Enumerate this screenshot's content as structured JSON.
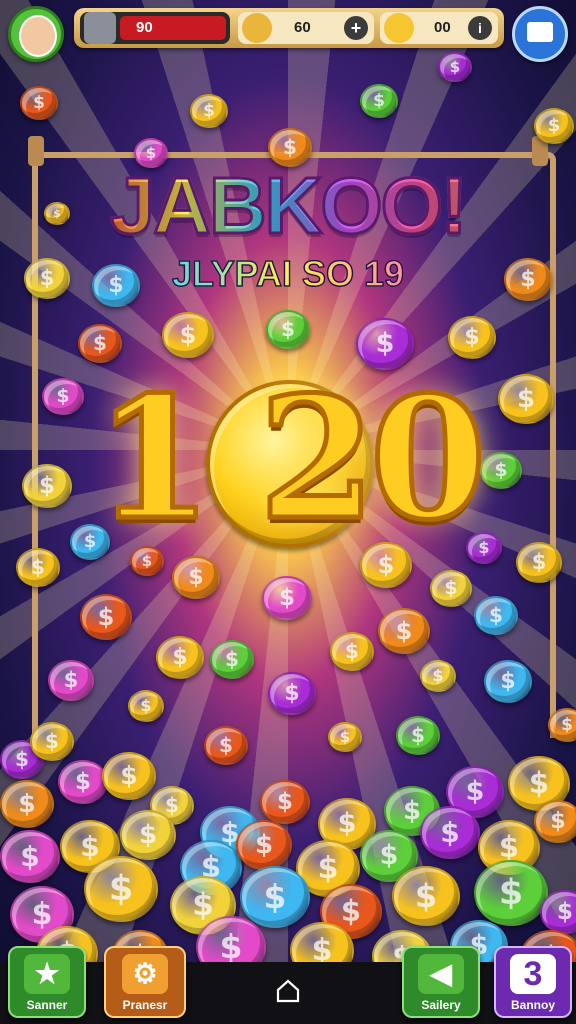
{
  "header": {
    "health_value": "90",
    "gold_value": "60",
    "gems_value": "00"
  },
  "title": {
    "main": "JABKOO!",
    "subtitle": "JLYPAI SO 19"
  },
  "prize": {
    "amount_text": "1 20"
  },
  "bottom_nav": {
    "btn1_label": "Sanner",
    "btn2_label": "Pranesr",
    "btn3_label": "Sailery",
    "btn4_label": "Bannoy",
    "btn4_icon_text": "3"
  },
  "icons": {
    "avatar": "avatar-icon",
    "menu": "puzzle-icon",
    "health": "helmet-icon",
    "gold": "knight-icon",
    "gems": "gem-icon",
    "btn1": "star-icon",
    "btn2": "gear-icon",
    "btn3": "arrow-left-icon",
    "home": "home-icon"
  },
  "colors": {
    "health_bar": "#c81a22",
    "accent_green": "#3fb53b",
    "accent_orange": "#f0a030",
    "accent_purple": "#7a35c8"
  }
}
